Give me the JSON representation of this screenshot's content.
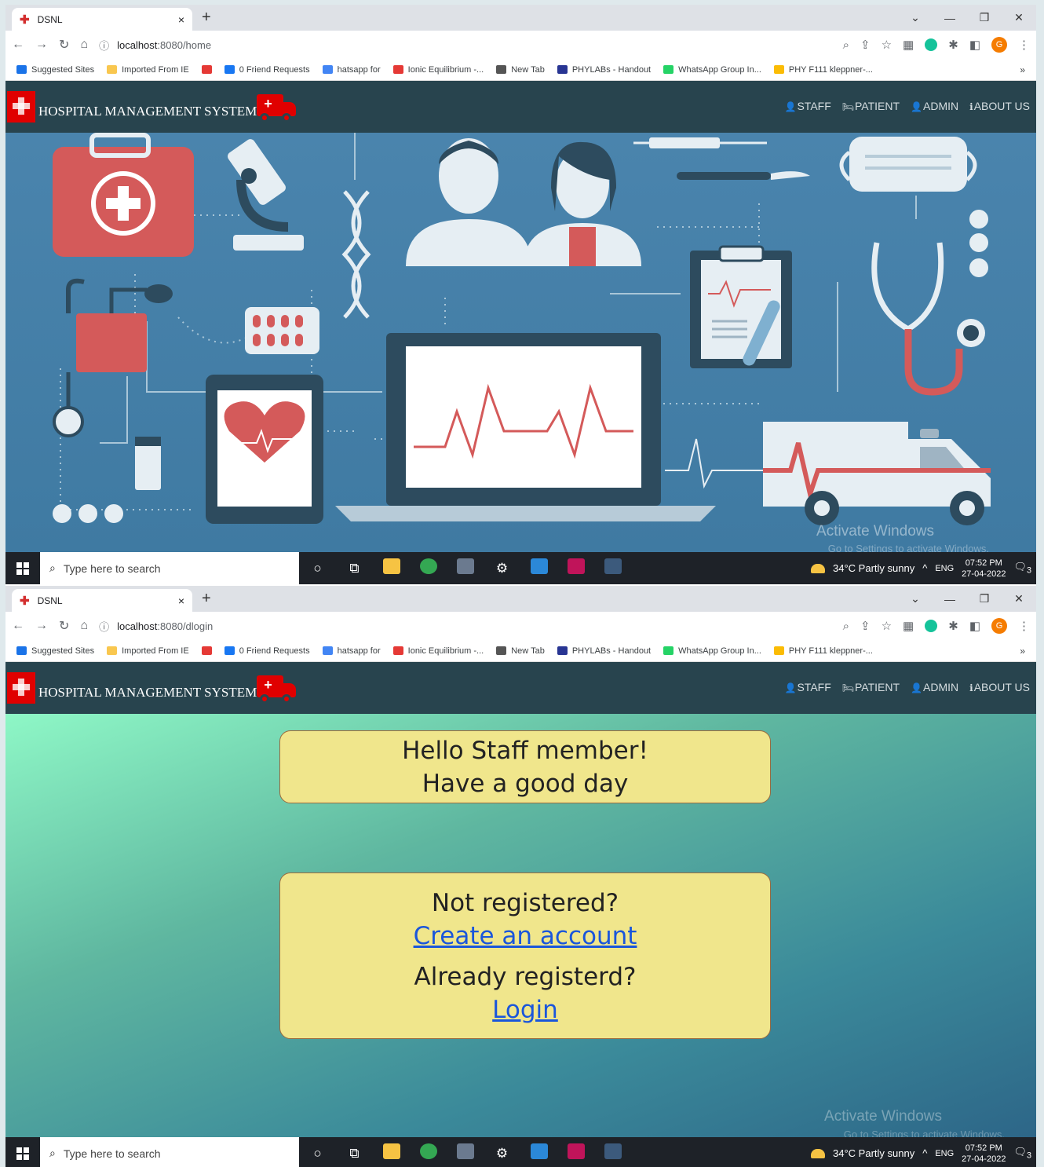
{
  "browser": {
    "tab_title": "DSNL",
    "tab_close": "×",
    "new_tab": "+",
    "bookmarks": [
      {
        "label": "Suggested Sites",
        "color": "#1a73e8"
      },
      {
        "label": "Imported From IE",
        "color": "#f9c74f"
      },
      {
        "label": "",
        "color": "#e53935"
      },
      {
        "label": "0 Friend Requests",
        "color": "#1877f2"
      },
      {
        "label": "hatsapp for",
        "color": "#4285f4"
      },
      {
        "label": "Ionic Equilibrium -...",
        "color": "#e53935"
      },
      {
        "label": "New Tab",
        "color": "#555555"
      },
      {
        "label": "PHYLABs - Handout",
        "color": "#283593"
      },
      {
        "label": "WhatsApp Group In...",
        "color": "#25d366"
      },
      {
        "label": "PHY F111 kleppner-...",
        "color": "#fbbc04"
      }
    ],
    "bookmarks_more": "»",
    "profile_initial": "G"
  },
  "screens": [
    {
      "url_host": "localhost",
      "url_rest": ":8080/home"
    },
    {
      "url_host": "localhost",
      "url_rest": ":8080/dlogin"
    }
  ],
  "site": {
    "brand": "HOSPITAL MANAGEMENT SYSTEM",
    "nav": [
      "STAFF",
      "PATIENT",
      "ADMIN",
      "ABOUT US"
    ]
  },
  "login": {
    "greeting_line1": "Hello Staff member!",
    "greeting_line2": "Have a good day",
    "not_registered": "Not registered?",
    "create_account": "Create an account",
    "already_registered": "Already registerd?",
    "login": "Login"
  },
  "watermark": {
    "title": "Activate Windows",
    "subtitle": "Go to Settings to activate Windows."
  },
  "taskbar": {
    "search_placeholder": "Type here to search",
    "weather": "34°C  Partly sunny",
    "lang": "ENG",
    "time": "07:52 PM",
    "date": "27-04-2022",
    "notif_count": "3"
  },
  "colors": {
    "header_bg": "#28444e",
    "logo_red": "#e00000",
    "card_bg": "#f0e68c",
    "link_blue": "#1a56db"
  }
}
